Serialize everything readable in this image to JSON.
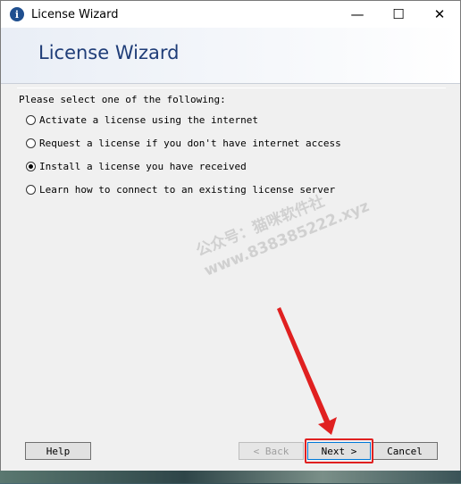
{
  "window": {
    "title": "License Wizard",
    "controls": {
      "minimize": "—",
      "maximize": "☐",
      "close": "✕"
    }
  },
  "header": {
    "title": "License Wizard"
  },
  "content": {
    "prompt": "Please select one of the following:",
    "options": [
      {
        "label": "Activate a license using the internet",
        "selected": false
      },
      {
        "label": "Request a license if you don't have internet access",
        "selected": false
      },
      {
        "label": "Install a license you have received",
        "selected": true
      },
      {
        "label": "Learn how to connect to an existing license server",
        "selected": false
      }
    ]
  },
  "watermark": {
    "line1": "公众号：猫咪软件社",
    "line2": "www.838385222.xyz"
  },
  "buttons": {
    "help": "Help",
    "back": "< Back",
    "next": "Next >",
    "cancel": "Cancel"
  },
  "annotation_color": "#e02020"
}
